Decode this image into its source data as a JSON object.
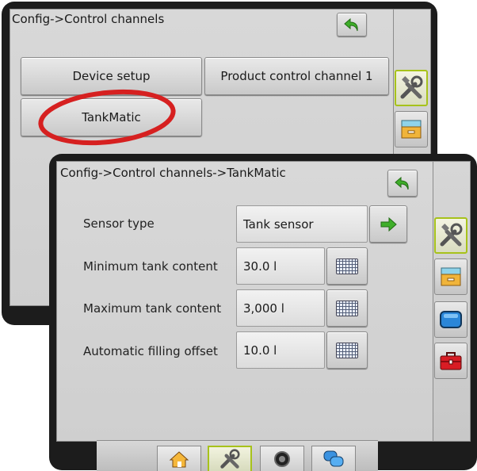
{
  "back_screen": {
    "breadcrumb": "Config->Control channels",
    "buttons": {
      "device_setup": "Device setup",
      "product_control_channel": "Product control channel 1",
      "tankmatic": "TankMatic"
    }
  },
  "front_screen": {
    "breadcrumb": "Config->Control channels->TankMatic",
    "rows": [
      {
        "label": "Sensor type",
        "value": "Tank sensor",
        "action_icon": "green-arrow-right-icon"
      },
      {
        "label": "Minimum tank content",
        "value": "30.0 l",
        "action_icon": "keyboard-icon"
      },
      {
        "label": "Maximum tank content",
        "value": "3,000 l",
        "action_icon": "keyboard-icon"
      },
      {
        "label": "Automatic filling offset",
        "value": "10.0 l",
        "action_icon": "keyboard-icon"
      }
    ],
    "side_tabs": [
      "tools-icon",
      "storage-drawer-icon",
      "blue-screen-icon",
      "red-toolbox-icon"
    ],
    "bottom_nav": [
      "home-icon",
      "tools-icon",
      "camera-icon",
      "chat-bubbles-icon"
    ]
  },
  "highlight": {
    "color": "#d62020",
    "target": "TankMatic"
  },
  "colors": {
    "accent_green": "#a7c21b",
    "arrow_green": "#3fae2a"
  }
}
